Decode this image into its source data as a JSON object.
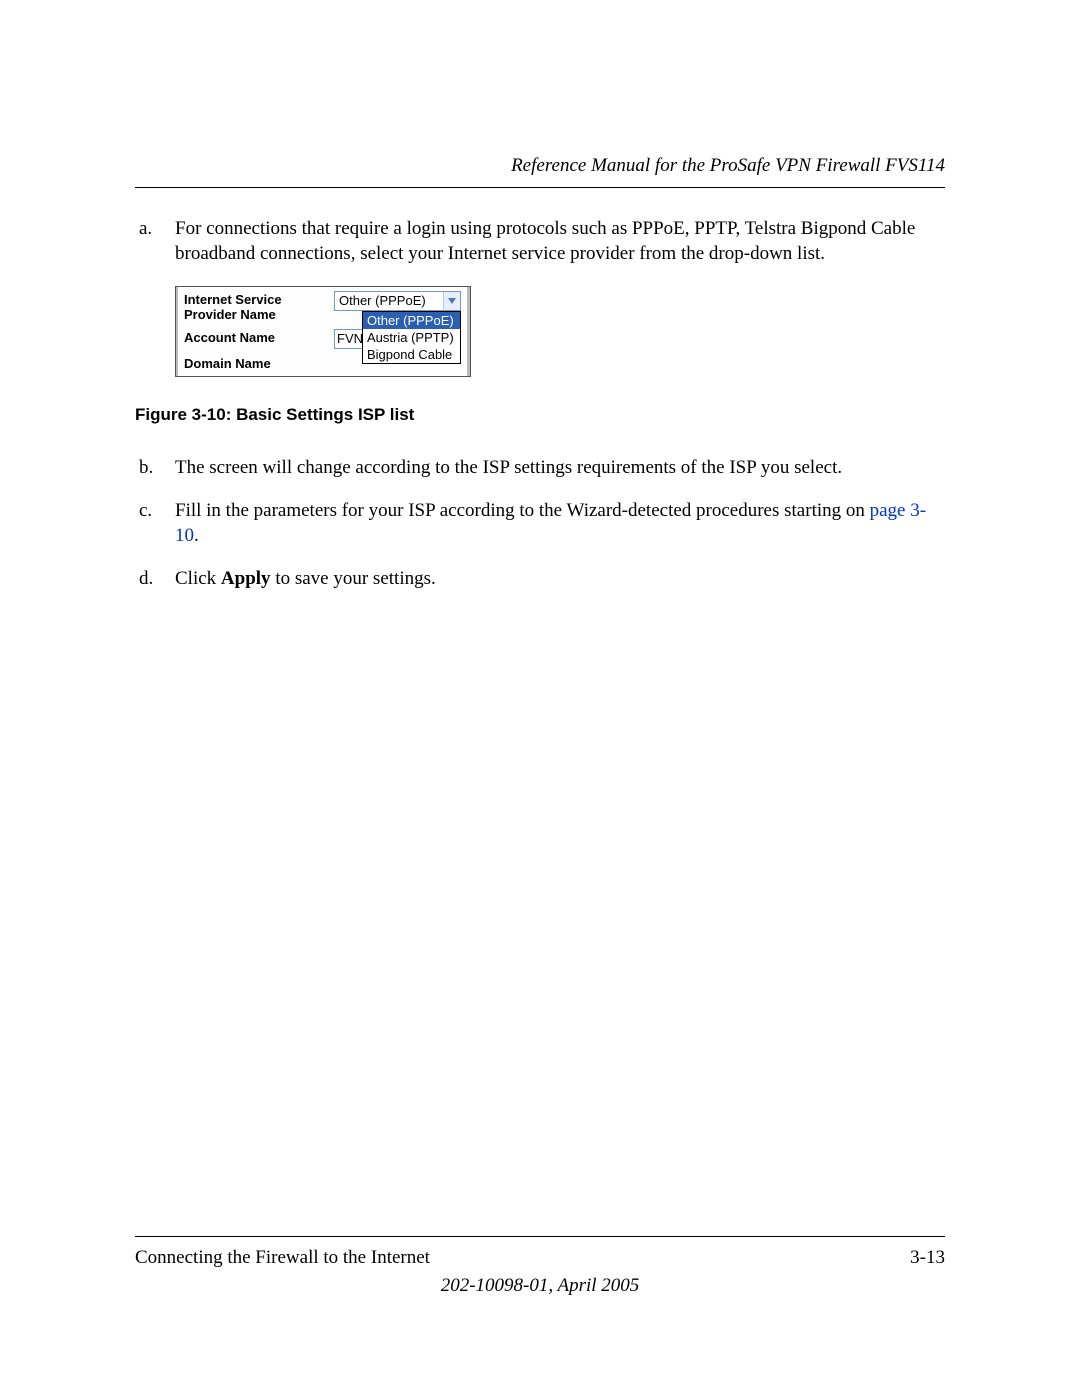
{
  "header": {
    "title": "Reference Manual for the ProSafe VPN Firewall FVS114"
  },
  "steps": {
    "a": {
      "marker": "a.",
      "text": "For connections that require a login using protocols such as PPPoE, PPTP, Telstra Bigpond Cable broadband connections, select your Internet service provider from the drop-down list."
    },
    "b": {
      "marker": "b.",
      "text": "The screen will change according to the ISP settings requirements of the ISP you select."
    },
    "c": {
      "marker": "c.",
      "text_before": "Fill in the parameters for your ISP according to the Wizard-detected procedures starting on ",
      "link_text": "page 3-10",
      "text_after": "."
    },
    "d": {
      "marker": "d.",
      "text_before": "Click ",
      "bold": "Apply",
      "text_after": " to save your settings."
    }
  },
  "screenshot": {
    "row1_label": "Internet Service Provider Name",
    "row1_value": "Other (PPPoE)",
    "row2_label": "Account Name",
    "row2_value": "FVN",
    "row3_label": "Domain Name",
    "dropdown": {
      "opt1": "Other (PPPoE)",
      "opt2": "Austria (PPTP)",
      "opt3": "Bigpond Cable"
    }
  },
  "figure_caption": "Figure 3-10: Basic Settings ISP list",
  "footer": {
    "section": "Connecting the Firewall to the Internet",
    "page": "3-13",
    "docinfo": "202-10098-01, April 2005"
  }
}
